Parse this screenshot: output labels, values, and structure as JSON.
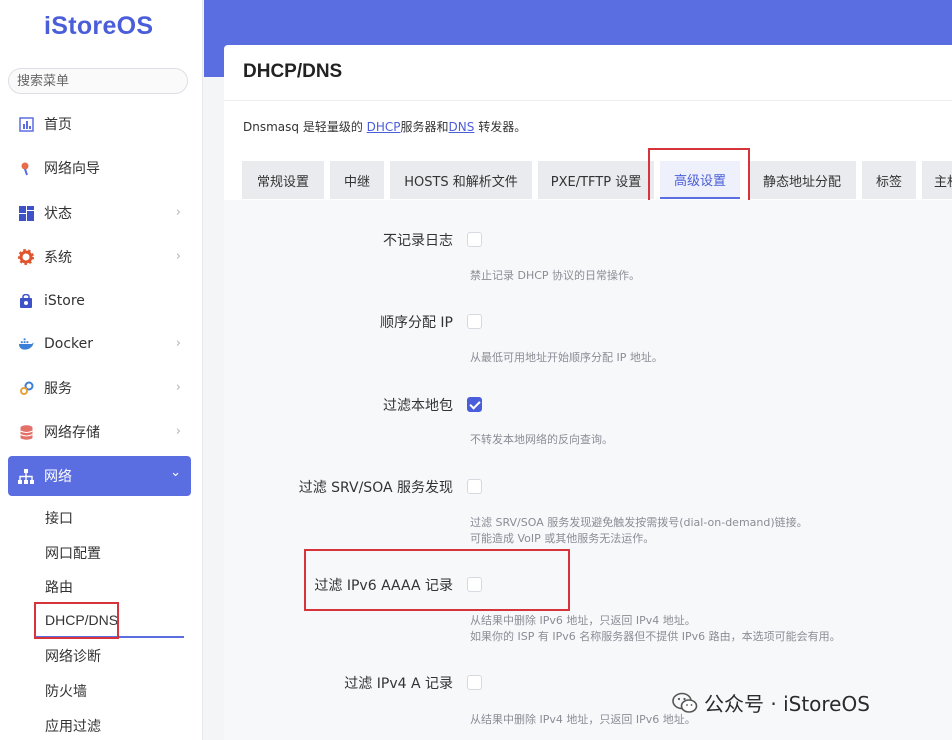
{
  "sidebar": {
    "logo": "iStoreOS",
    "search_placeholder": "搜索菜单",
    "items": [
      {
        "label": "首页",
        "icon": "home-icon",
        "arrow": ""
      },
      {
        "label": "网络向导",
        "icon": "wizard-icon",
        "arrow": ""
      },
      {
        "label": "状态",
        "icon": "status-icon",
        "arrow": "›"
      },
      {
        "label": "系统",
        "icon": "gear-icon",
        "arrow": "›"
      },
      {
        "label": "iStore",
        "icon": "store-icon",
        "arrow": ""
      },
      {
        "label": "Docker",
        "icon": "docker-icon",
        "arrow": "›"
      },
      {
        "label": "服务",
        "icon": "services-icon",
        "arrow": "›"
      },
      {
        "label": "网络存储",
        "icon": "storage-icon",
        "arrow": "›"
      },
      {
        "label": "网络",
        "icon": "network-icon",
        "arrow": "⌄"
      }
    ],
    "submenu": [
      "接口",
      "网口配置",
      "路由",
      "DHCP/DNS",
      "网络诊断",
      "防火墙",
      "应用过滤"
    ]
  },
  "page": {
    "title": "DHCP/DNS",
    "desc_prefix": "Dnsmasq 是轻量级的 ",
    "desc_link1": "DHCP",
    "desc_mid": "服务器和",
    "desc_link2": "DNS",
    "desc_suffix": " 转发器。"
  },
  "tabs": [
    "常规设置",
    "中继",
    "HOSTS 和解析文件",
    "PXE/TFTP 设置",
    "高级设置",
    "静态地址分配",
    "标签",
    "主机"
  ],
  "active_tab": "高级设置",
  "options": [
    {
      "label": "不记录日志",
      "checked": false,
      "help": [
        "禁止记录 DHCP 协议的日常操作。"
      ]
    },
    {
      "label": "顺序分配 IP",
      "checked": false,
      "help": [
        "从最低可用地址开始顺序分配 IP 地址。"
      ]
    },
    {
      "label": "过滤本地包",
      "checked": true,
      "help": [
        "不转发本地网络的反向查询。"
      ]
    },
    {
      "label": "过滤 SRV/SOA 服务发现",
      "checked": false,
      "help": [
        "过滤 SRV/SOA 服务发现避免触发按需拨号(dial-on-demand)链接。",
        "可能造成 VoIP 或其他服务无法运作。"
      ]
    },
    {
      "label": "过滤 IPv6 AAAA 记录",
      "checked": false,
      "help": [
        "从结果中删除 IPv6 地址，只返回 IPv4 地址。",
        "如果你的 ISP 有 IPv6 名称服务器但不提供 IPv6 路由，本选项可能会有用。"
      ]
    },
    {
      "label": "过滤 IPv4 A 记录",
      "checked": false,
      "help": [
        "从结果中删除 IPv4 地址，只返回 IPv6 地址。"
      ]
    }
  ],
  "watermark": "公众号 · iStoreOS",
  "colors": {
    "accent": "#5b6ee1",
    "highlight": "#d6333b",
    "checkbox": "#4b5ed9"
  }
}
